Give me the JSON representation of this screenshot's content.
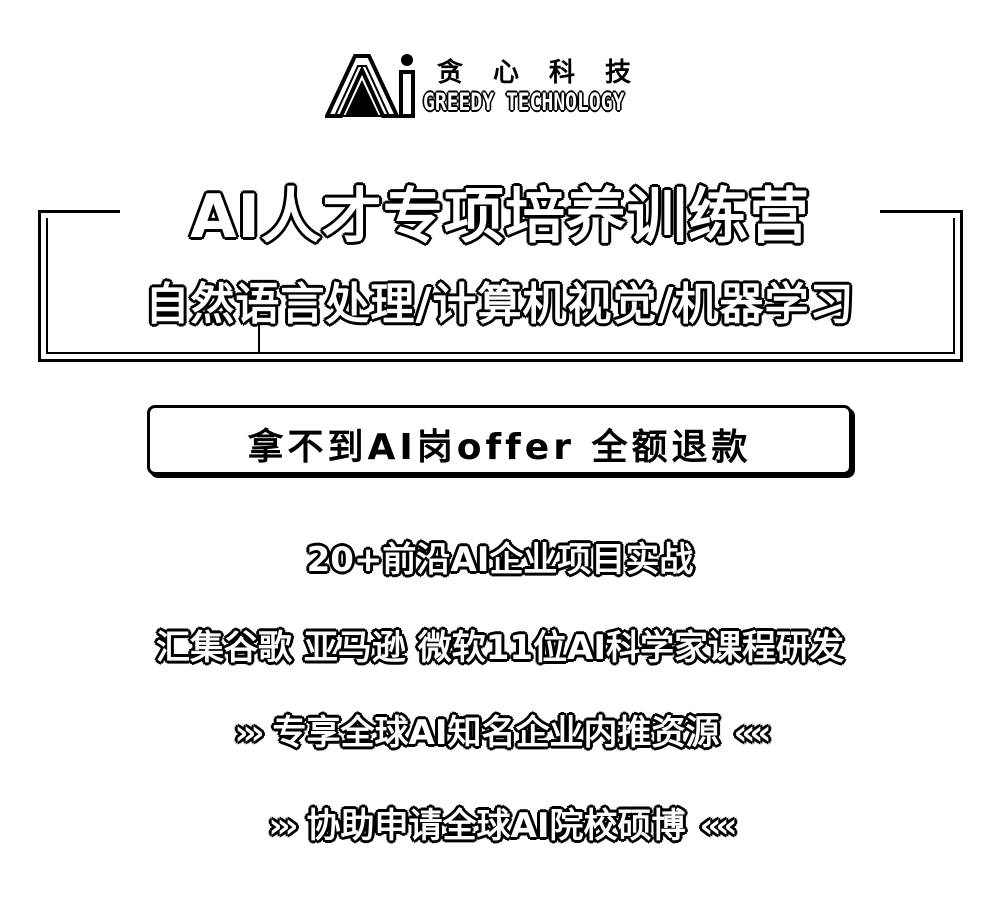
{
  "logo": {
    "mark_text": "Ai",
    "cn_name": "贪心科技",
    "en_name": "GREEDY TECHNOLOGY"
  },
  "title": {
    "main": "AI人才专项培养训练营",
    "sub": "自然语言处理/计算机视觉/机器学习"
  },
  "offer": {
    "text": "拿不到AI岗offer 全额退款"
  },
  "features": {
    "line1": "20+前沿AI企业项目实战",
    "line2": "汇集谷歌  亚马逊  微软11位AI科学家课程研发",
    "line3": "专享全球AI知名企业内推资源",
    "line4": "协助申请全球AI院校硕博",
    "arrow_right": "›››",
    "arrow_left": "‹‹‹‹"
  },
  "colors": {
    "ink": "#000000",
    "paper": "#ffffff"
  }
}
